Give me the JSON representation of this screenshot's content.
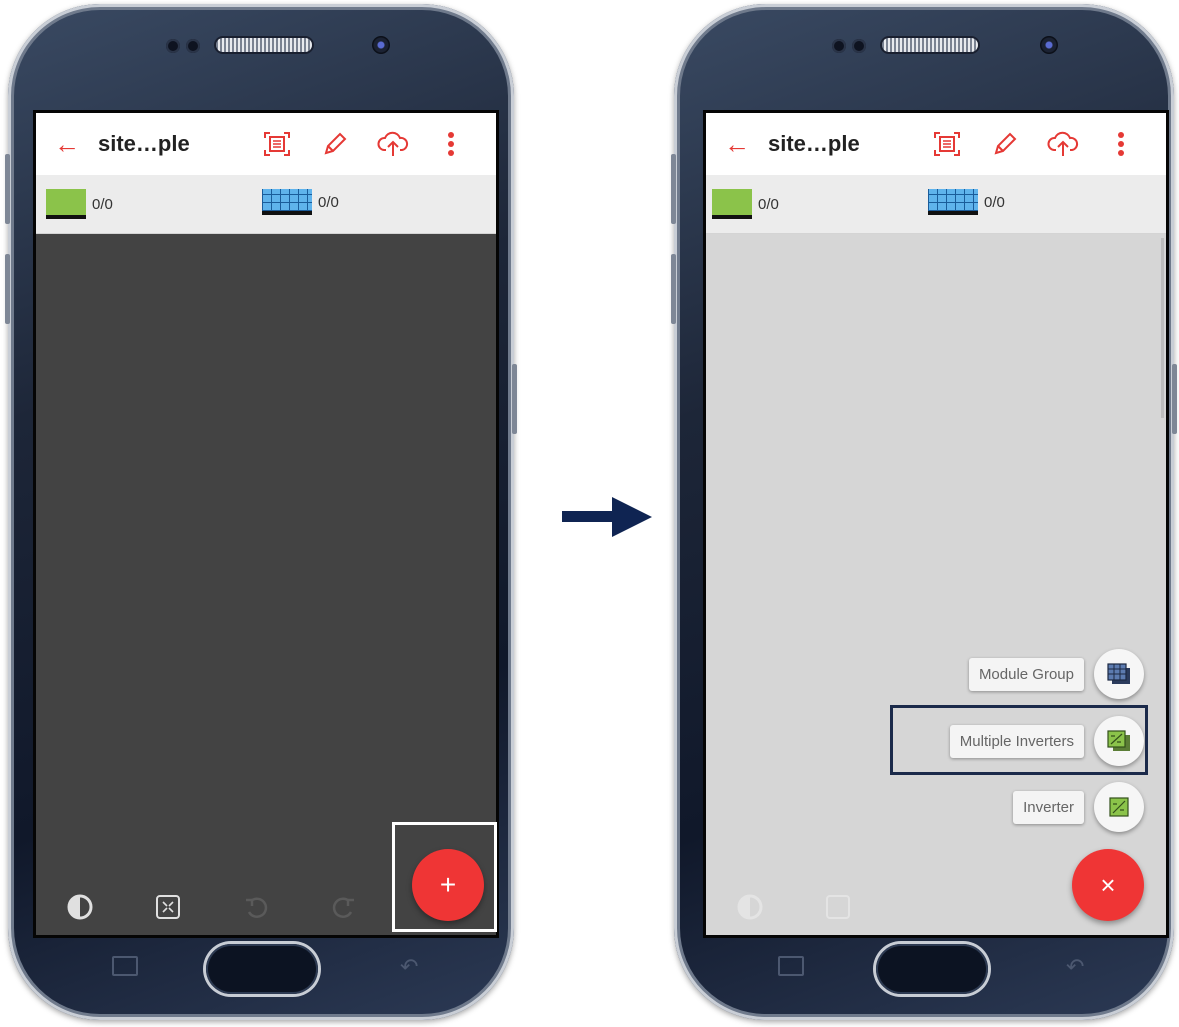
{
  "colors": {
    "accent_red": "#ef3535",
    "highlight_left": "#ffffff",
    "highlight_right": "#1b2a4a",
    "arrow": "#0f2452"
  },
  "before_screen": {
    "appbar": {
      "back_icon": "arrow-left-icon",
      "title": "site…ple",
      "tools": [
        "scan-icon",
        "pencil-icon",
        "cloud-upload-icon",
        "overflow-menu-icon"
      ]
    },
    "counters": {
      "inverter_count": "0/0",
      "module_count": "0/0"
    },
    "bottom_tools": [
      "contrast-icon",
      "fit-screen-icon",
      "undo-icon",
      "redo-icon"
    ],
    "fab_label": "+"
  },
  "after_screen": {
    "appbar": {
      "back_icon": "arrow-left-icon",
      "title": "site…ple",
      "tools": [
        "scan-icon",
        "pencil-icon",
        "cloud-upload-icon",
        "overflow-menu-icon"
      ]
    },
    "counters": {
      "inverter_count": "0/0",
      "module_count": "0/0"
    },
    "fab_menu": [
      {
        "label": "Module Group",
        "icon": "module-group-icon"
      },
      {
        "label": "Multiple Inverters",
        "icon": "multiple-inverters-icon"
      },
      {
        "label": "Inverter",
        "icon": "inverter-icon"
      }
    ],
    "fab_label": "×"
  },
  "transition_arrow_icon": "arrow-right-icon"
}
